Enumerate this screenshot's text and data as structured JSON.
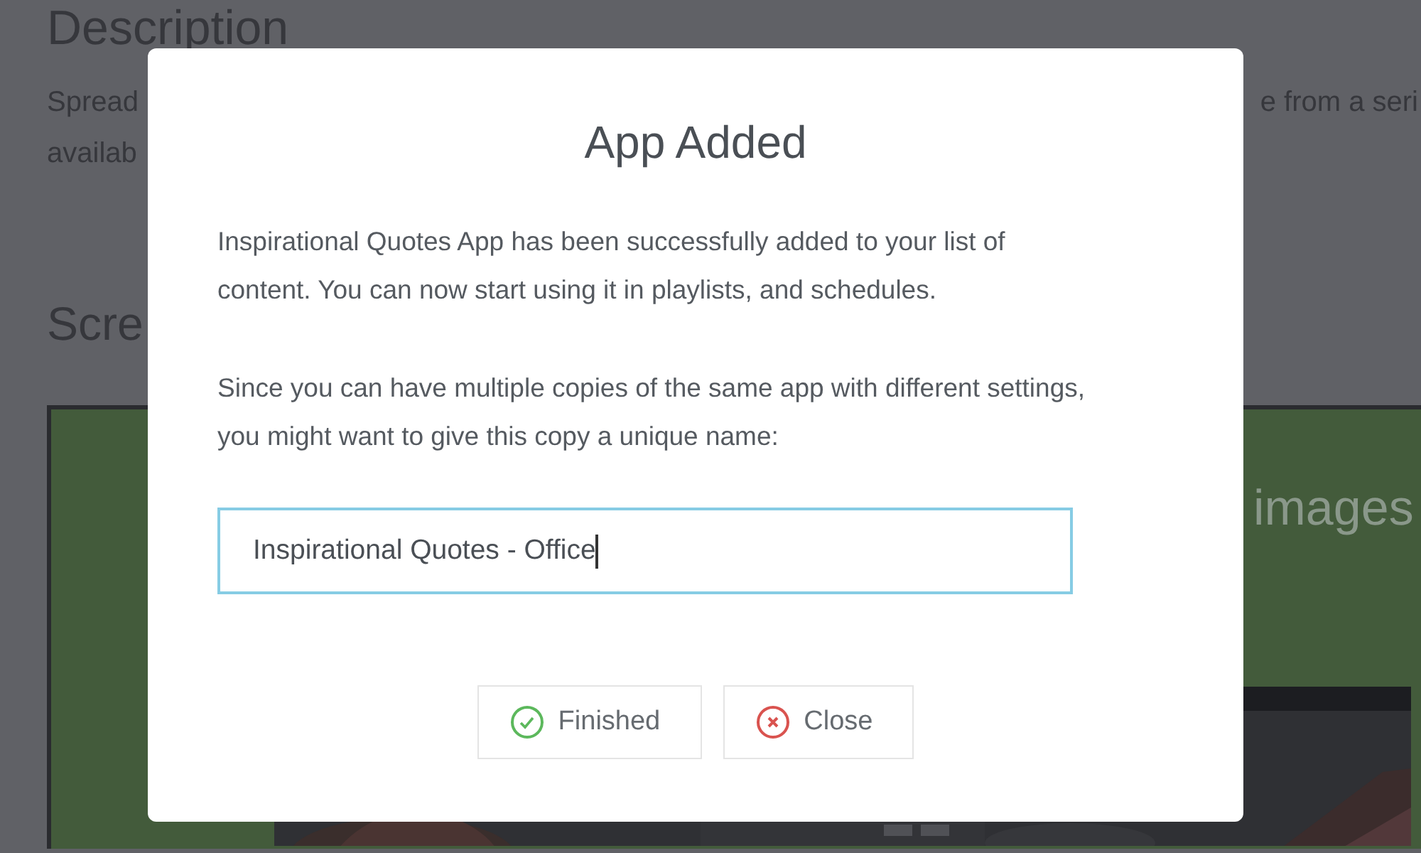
{
  "page": {
    "description_heading": "Description",
    "description_lines": [
      "Spread",
      "availab"
    ],
    "description_fragment": "e from a seri",
    "screenshots_heading": "Scre",
    "preview": {
      "caption": "images"
    }
  },
  "dialog": {
    "title": "App Added",
    "paragraphs": [
      "Inspirational Quotes App has been successfully added to your list of\ncontent. You can now start using it in playlists, and schedules.",
      "Since you can have multiple copies of the same app with different settings,\nyou might want to give this copy a unique name:"
    ],
    "name_field": {
      "value": "Inspirational Quotes - Office",
      "focused": true
    },
    "buttons": [
      {
        "label": "Finished",
        "kind": "confirm"
      },
      {
        "label": "Close",
        "kind": "cancel"
      }
    ]
  }
}
